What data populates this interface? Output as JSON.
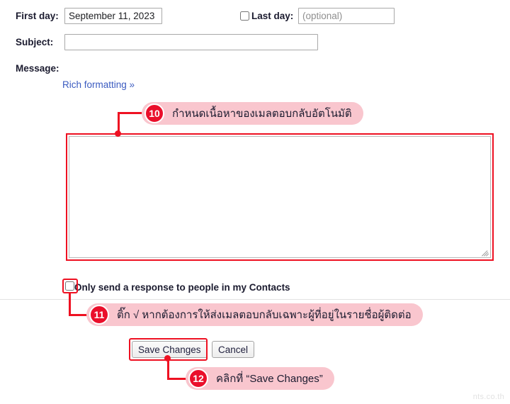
{
  "form": {
    "first_day": {
      "label": "First day:",
      "value": "September 11, 2023"
    },
    "last_day": {
      "label": "Last day:",
      "placeholder": "(optional)",
      "value": "",
      "checked": false
    },
    "subject": {
      "label": "Subject:",
      "value": "",
      "placeholder": ""
    },
    "message": {
      "label": "Message:",
      "value": "",
      "placeholder": "",
      "rich_formatting_link": "Rich formatting »"
    },
    "contacts_only": {
      "label": "Only send a response to people in my Contacts",
      "checked": false
    }
  },
  "buttons": {
    "save": "Save Changes",
    "cancel": "Cancel"
  },
  "annotations": [
    {
      "number": "10",
      "text": "กำหนดเนื้อหาของเมลตอบกลับอัตโนมัติ"
    },
    {
      "number": "11",
      "text": "ติ๊ก √ หากต้องการให้ส่งเมลตอบกลับเฉพาะผู้ที่อยู่ในรายชื่อผู้ติดต่อ"
    },
    {
      "number": "12",
      "text": "คลิกที่ “Save Changes”"
    }
  ],
  "watermark": "nts.co.th",
  "colors": {
    "annotation_red": "#ee1122",
    "badge_red": "#ea0f2b",
    "callout_pink": "#f9c6ce",
    "link_blue": "#3b5bc0"
  }
}
